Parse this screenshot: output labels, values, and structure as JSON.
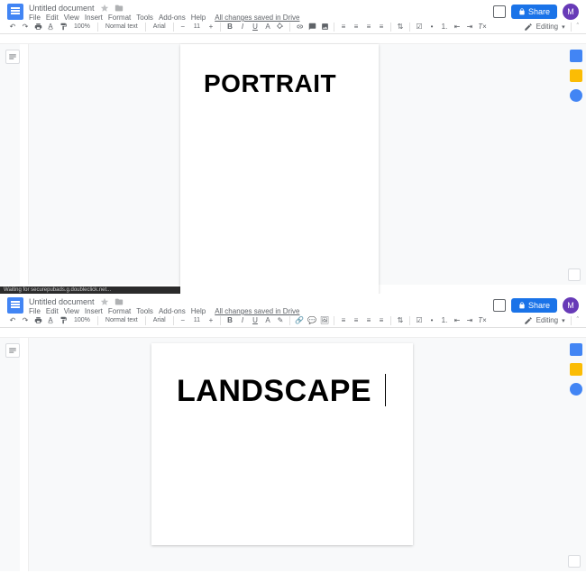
{
  "app": {
    "doc_title": "Untitled document",
    "share_label": "Share",
    "avatar_initial": "M",
    "editing_label": "Editing",
    "save_status": "All changes saved in Drive",
    "status_bar": "Waiting for securepubads.g.doubleclick.net..."
  },
  "menubar": [
    "File",
    "Edit",
    "View",
    "Insert",
    "Format",
    "Tools",
    "Add-ons",
    "Help"
  ],
  "toolbar": {
    "zoom": "100%",
    "style": "Normal text",
    "font": "Arial",
    "size": "11"
  },
  "pages": {
    "top_text": "PORTRAIT",
    "bottom_text": "LANDSCAPE"
  }
}
